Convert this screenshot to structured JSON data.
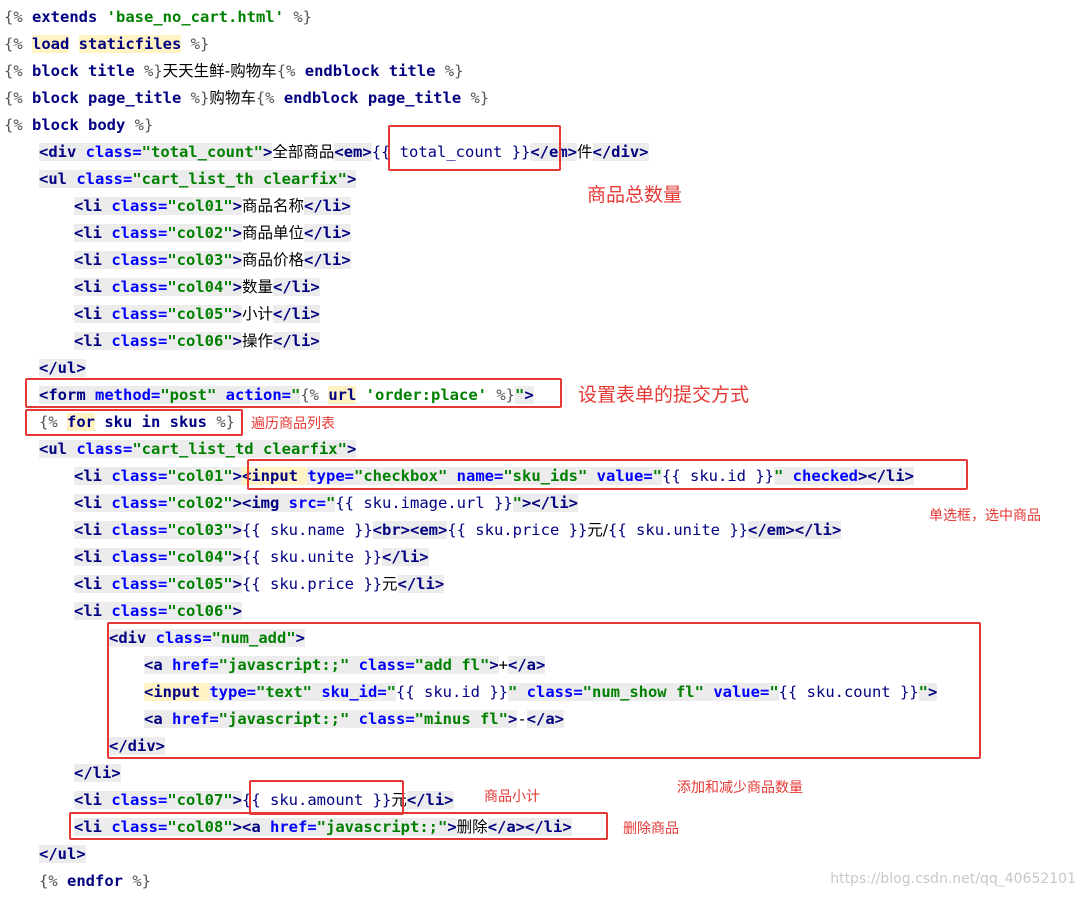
{
  "code_lines": [
    {
      "indent": 0,
      "tokens": [
        {
          "t": "{% ",
          "c": "tmpl"
        },
        {
          "t": "extends",
          "c": "kw"
        },
        {
          "t": " ",
          "c": "tmpl"
        },
        {
          "t": "'base_no_cart.html'",
          "c": "str"
        },
        {
          "t": " %}",
          "c": "tmpl"
        }
      ]
    },
    {
      "indent": 0,
      "tokens": [
        {
          "t": "{% ",
          "c": "tmpl"
        },
        {
          "t": "load",
          "c": "kw mark"
        },
        {
          "t": " ",
          "c": "tmpl"
        },
        {
          "t": "staticfiles",
          "c": "kw mark"
        },
        {
          "t": " %}",
          "c": "tmpl"
        }
      ]
    },
    {
      "indent": 0,
      "tokens": [
        {
          "t": "{% ",
          "c": "tmpl"
        },
        {
          "t": "block",
          "c": "kw"
        },
        {
          "t": " title ",
          "c": "kw"
        },
        {
          "t": "%}",
          "c": "tmpl"
        },
        {
          "t": "天天生鲜-购物车",
          "c": "txt-plain cjk"
        },
        {
          "t": "{% ",
          "c": "tmpl"
        },
        {
          "t": "endblock",
          "c": "kw"
        },
        {
          "t": " title ",
          "c": "kw"
        },
        {
          "t": "%}",
          "c": "tmpl"
        }
      ]
    },
    {
      "indent": 0,
      "tokens": [
        {
          "t": "{% ",
          "c": "tmpl"
        },
        {
          "t": "block",
          "c": "kw"
        },
        {
          "t": " page_title ",
          "c": "kw"
        },
        {
          "t": "%}",
          "c": "tmpl"
        },
        {
          "t": "购物车",
          "c": "txt-plain cjk"
        },
        {
          "t": "{% ",
          "c": "tmpl"
        },
        {
          "t": "endblock",
          "c": "kw"
        },
        {
          "t": " page_title ",
          "c": "kw"
        },
        {
          "t": "%}",
          "c": "tmpl"
        }
      ]
    },
    {
      "indent": 0,
      "tokens": [
        {
          "t": "{% ",
          "c": "tmpl"
        },
        {
          "t": "block",
          "c": "kw"
        },
        {
          "t": " body ",
          "c": "kw"
        },
        {
          "t": "%}",
          "c": "tmpl"
        }
      ]
    },
    {
      "indent": 1,
      "tokens": [
        {
          "t": "<div ",
          "c": "tag hl"
        },
        {
          "t": "class=",
          "c": "attr hl"
        },
        {
          "t": "\"total_count\"",
          "c": "str hl"
        },
        {
          "t": ">",
          "c": "tag hl"
        },
        {
          "t": "全部商品",
          "c": "txt-plain cjk"
        },
        {
          "t": "<em>",
          "c": "tag hl"
        },
        {
          "t": "{{ total_count }}",
          "c": "var"
        },
        {
          "t": "</em>",
          "c": "tag hl"
        },
        {
          "t": "件",
          "c": "txt-plain cjk"
        },
        {
          "t": "</div>",
          "c": "tag hl"
        }
      ]
    },
    {
      "indent": 1,
      "tokens": [
        {
          "t": "<ul ",
          "c": "tag hl"
        },
        {
          "t": "class=",
          "c": "attr hl"
        },
        {
          "t": "\"cart_list_th clearfix\"",
          "c": "str hl"
        },
        {
          "t": ">",
          "c": "tag hl"
        }
      ]
    },
    {
      "indent": 2,
      "tokens": [
        {
          "t": "<li ",
          "c": "tag hl"
        },
        {
          "t": "class=",
          "c": "attr hl"
        },
        {
          "t": "\"col01\"",
          "c": "str hl"
        },
        {
          "t": ">",
          "c": "tag hl"
        },
        {
          "t": "商品名称",
          "c": "txt-plain cjk"
        },
        {
          "t": "</li>",
          "c": "tag hl"
        }
      ]
    },
    {
      "indent": 2,
      "tokens": [
        {
          "t": "<li ",
          "c": "tag hl"
        },
        {
          "t": "class=",
          "c": "attr hl"
        },
        {
          "t": "\"col02\"",
          "c": "str hl"
        },
        {
          "t": ">",
          "c": "tag hl"
        },
        {
          "t": "商品单位",
          "c": "txt-plain cjk"
        },
        {
          "t": "</li>",
          "c": "tag hl"
        }
      ]
    },
    {
      "indent": 2,
      "tokens": [
        {
          "t": "<li ",
          "c": "tag hl"
        },
        {
          "t": "class=",
          "c": "attr hl"
        },
        {
          "t": "\"col03\"",
          "c": "str hl"
        },
        {
          "t": ">",
          "c": "tag hl"
        },
        {
          "t": "商品价格",
          "c": "txt-plain cjk"
        },
        {
          "t": "</li>",
          "c": "tag hl"
        }
      ]
    },
    {
      "indent": 2,
      "tokens": [
        {
          "t": "<li ",
          "c": "tag hl"
        },
        {
          "t": "class=",
          "c": "attr hl"
        },
        {
          "t": "\"col04\"",
          "c": "str hl"
        },
        {
          "t": ">",
          "c": "tag hl"
        },
        {
          "t": "数量",
          "c": "txt-plain cjk"
        },
        {
          "t": "</li>",
          "c": "tag hl"
        }
      ]
    },
    {
      "indent": 2,
      "tokens": [
        {
          "t": "<li ",
          "c": "tag hl"
        },
        {
          "t": "class=",
          "c": "attr hl"
        },
        {
          "t": "\"col05\"",
          "c": "str hl"
        },
        {
          "t": ">",
          "c": "tag hl"
        },
        {
          "t": "小计",
          "c": "txt-plain cjk"
        },
        {
          "t": "</li>",
          "c": "tag hl"
        }
      ]
    },
    {
      "indent": 2,
      "tokens": [
        {
          "t": "<li ",
          "c": "tag hl"
        },
        {
          "t": "class=",
          "c": "attr hl"
        },
        {
          "t": "\"col06\"",
          "c": "str hl"
        },
        {
          "t": ">",
          "c": "tag hl"
        },
        {
          "t": "操作",
          "c": "txt-plain cjk"
        },
        {
          "t": "</li>",
          "c": "tag hl"
        }
      ]
    },
    {
      "indent": 1,
      "tokens": [
        {
          "t": "</ul>",
          "c": "tag hl"
        }
      ]
    },
    {
      "indent": 1,
      "tokens": [
        {
          "t": "<form ",
          "c": "tag hl"
        },
        {
          "t": "method=",
          "c": "attr hl"
        },
        {
          "t": "\"post\"",
          "c": "str hl"
        },
        {
          "t": " action=",
          "c": "attr hl"
        },
        {
          "t": "\"",
          "c": "str hl"
        },
        {
          "t": "{% ",
          "c": "tmpl"
        },
        {
          "t": "url",
          "c": "kw mark"
        },
        {
          "t": " ",
          "c": "tmpl"
        },
        {
          "t": "'order:place'",
          "c": "str"
        },
        {
          "t": " %}",
          "c": "tmpl"
        },
        {
          "t": "\"",
          "c": "str hl"
        },
        {
          "t": ">",
          "c": "tag hl"
        }
      ]
    },
    {
      "indent": 1,
      "tokens": [
        {
          "t": "{% ",
          "c": "tmpl"
        },
        {
          "t": "for",
          "c": "kw mark"
        },
        {
          "t": " sku ",
          "c": "kw"
        },
        {
          "t": "in",
          "c": "kw"
        },
        {
          "t": " skus ",
          "c": "kw"
        },
        {
          "t": "%}",
          "c": "tmpl"
        }
      ]
    },
    {
      "indent": 1,
      "tokens": [
        {
          "t": "<ul ",
          "c": "tag hl"
        },
        {
          "t": "class=",
          "c": "attr hl"
        },
        {
          "t": "\"cart_list_td clearfix\"",
          "c": "str hl"
        },
        {
          "t": ">",
          "c": "tag hl"
        }
      ]
    },
    {
      "indent": 2,
      "tokens": [
        {
          "t": "<li ",
          "c": "tag hl"
        },
        {
          "t": "class=",
          "c": "attr hl"
        },
        {
          "t": "\"col01\"",
          "c": "str hl"
        },
        {
          "t": ">",
          "c": "tag hl"
        },
        {
          "t": "<input ",
          "c": "tag mark"
        },
        {
          "t": "type=",
          "c": "attr hl"
        },
        {
          "t": "\"checkbox\"",
          "c": "str hl"
        },
        {
          "t": " name=",
          "c": "attr hl"
        },
        {
          "t": "\"sku_ids\"",
          "c": "str hl"
        },
        {
          "t": " value=",
          "c": "attr hl"
        },
        {
          "t": "\"",
          "c": "str hl"
        },
        {
          "t": "{{ sku.id }}",
          "c": "var"
        },
        {
          "t": "\"",
          "c": "str hl"
        },
        {
          "t": " checked",
          "c": "attr hl"
        },
        {
          "t": ">",
          "c": "tag hl"
        },
        {
          "t": "</li>",
          "c": "tag hl"
        }
      ]
    },
    {
      "indent": 2,
      "tokens": [
        {
          "t": "<li ",
          "c": "tag hl"
        },
        {
          "t": "class=",
          "c": "attr hl"
        },
        {
          "t": "\"col02\"",
          "c": "str hl"
        },
        {
          "t": ">",
          "c": "tag hl"
        },
        {
          "t": "<img ",
          "c": "tag hl"
        },
        {
          "t": "src=",
          "c": "attr hl"
        },
        {
          "t": "\"",
          "c": "str hl"
        },
        {
          "t": "{{ sku.image.url }}",
          "c": "var"
        },
        {
          "t": "\"",
          "c": "str hl"
        },
        {
          "t": ">",
          "c": "tag hl"
        },
        {
          "t": "</li>",
          "c": "tag hl"
        }
      ]
    },
    {
      "indent": 2,
      "tokens": [
        {
          "t": "<li ",
          "c": "tag hl"
        },
        {
          "t": "class=",
          "c": "attr hl"
        },
        {
          "t": "\"col03\"",
          "c": "str hl"
        },
        {
          "t": ">",
          "c": "tag hl"
        },
        {
          "t": "{{ sku.name }}",
          "c": "var"
        },
        {
          "t": "<br>",
          "c": "tag hl"
        },
        {
          "t": "<em>",
          "c": "tag hl"
        },
        {
          "t": "{{ sku.price }}",
          "c": "var"
        },
        {
          "t": "元/",
          "c": "txt-plain cjk"
        },
        {
          "t": "{{ sku.unite }}",
          "c": "var"
        },
        {
          "t": "</em>",
          "c": "tag hl"
        },
        {
          "t": "</li>",
          "c": "tag hl"
        }
      ]
    },
    {
      "indent": 2,
      "tokens": [
        {
          "t": "<li ",
          "c": "tag hl"
        },
        {
          "t": "class=",
          "c": "attr hl"
        },
        {
          "t": "\"col04\"",
          "c": "str hl"
        },
        {
          "t": ">",
          "c": "tag hl"
        },
        {
          "t": "{{ sku.unite }}",
          "c": "var"
        },
        {
          "t": "</li>",
          "c": "tag hl"
        }
      ]
    },
    {
      "indent": 2,
      "tokens": [
        {
          "t": "<li ",
          "c": "tag hl"
        },
        {
          "t": "class=",
          "c": "attr hl"
        },
        {
          "t": "\"col05\"",
          "c": "str hl"
        },
        {
          "t": ">",
          "c": "tag hl"
        },
        {
          "t": "{{ sku.price }}",
          "c": "var"
        },
        {
          "t": "元",
          "c": "txt-plain cjk"
        },
        {
          "t": "</li>",
          "c": "tag hl"
        }
      ]
    },
    {
      "indent": 2,
      "tokens": [
        {
          "t": "<li ",
          "c": "tag hl"
        },
        {
          "t": "class=",
          "c": "attr hl"
        },
        {
          "t": "\"col06\"",
          "c": "str hl"
        },
        {
          "t": ">",
          "c": "tag hl"
        }
      ]
    },
    {
      "indent": 3,
      "tokens": [
        {
          "t": "<div ",
          "c": "tag hl"
        },
        {
          "t": "class=",
          "c": "attr hl"
        },
        {
          "t": "\"num_add\"",
          "c": "str hl"
        },
        {
          "t": ">",
          "c": "tag hl"
        }
      ]
    },
    {
      "indent": 4,
      "tokens": [
        {
          "t": "<a ",
          "c": "tag hl"
        },
        {
          "t": "href=",
          "c": "attr hl"
        },
        {
          "t": "\"javascript:;\"",
          "c": "str hl"
        },
        {
          "t": " class=",
          "c": "attr hl"
        },
        {
          "t": "\"add fl\"",
          "c": "str hl"
        },
        {
          "t": ">",
          "c": "tag hl"
        },
        {
          "t": "+",
          "c": "txt-plain"
        },
        {
          "t": "</a>",
          "c": "tag hl"
        }
      ]
    },
    {
      "indent": 4,
      "tokens": [
        {
          "t": "<input ",
          "c": "tag mark"
        },
        {
          "t": "type=",
          "c": "attr hl"
        },
        {
          "t": "\"text\"",
          "c": "str hl"
        },
        {
          "t": " sku_id=",
          "c": "attr hl"
        },
        {
          "t": "\"",
          "c": "str hl"
        },
        {
          "t": "{{ sku.id }}",
          "c": "var"
        },
        {
          "t": "\"",
          "c": "str hl"
        },
        {
          "t": " class=",
          "c": "attr hl"
        },
        {
          "t": "\"num_show fl\"",
          "c": "str hl"
        },
        {
          "t": " value=",
          "c": "attr hl"
        },
        {
          "t": "\"",
          "c": "str hl"
        },
        {
          "t": "{{ sku.count }}",
          "c": "var"
        },
        {
          "t": "\"",
          "c": "str hl"
        },
        {
          "t": ">",
          "c": "tag hl"
        }
      ]
    },
    {
      "indent": 4,
      "tokens": [
        {
          "t": "<a ",
          "c": "tag hl"
        },
        {
          "t": "href=",
          "c": "attr hl"
        },
        {
          "t": "\"javascript:;\"",
          "c": "str hl"
        },
        {
          "t": " class=",
          "c": "attr hl"
        },
        {
          "t": "\"minus fl\"",
          "c": "str hl"
        },
        {
          "t": ">",
          "c": "tag hl"
        },
        {
          "t": "-",
          "c": "txt-plain"
        },
        {
          "t": "</a>",
          "c": "tag hl"
        }
      ]
    },
    {
      "indent": 3,
      "tokens": [
        {
          "t": "</div>",
          "c": "tag hl"
        }
      ]
    },
    {
      "indent": 2,
      "tokens": [
        {
          "t": "</li>",
          "c": "tag hl"
        }
      ]
    },
    {
      "indent": 2,
      "tokens": [
        {
          "t": "<li ",
          "c": "tag hl"
        },
        {
          "t": "class=",
          "c": "attr hl"
        },
        {
          "t": "\"col07\"",
          "c": "str hl"
        },
        {
          "t": ">",
          "c": "tag hl"
        },
        {
          "t": "{{ sku.amount }}",
          "c": "var"
        },
        {
          "t": "元",
          "c": "txt-plain cjk"
        },
        {
          "t": "</li>",
          "c": "tag hl"
        }
      ]
    },
    {
      "indent": 2,
      "tokens": [
        {
          "t": "<li ",
          "c": "tag hl"
        },
        {
          "t": "class=",
          "c": "attr hl"
        },
        {
          "t": "\"col08\"",
          "c": "str hl"
        },
        {
          "t": ">",
          "c": "tag hl"
        },
        {
          "t": "<a ",
          "c": "tag hl"
        },
        {
          "t": "href=",
          "c": "attr hl"
        },
        {
          "t": "\"javascript:;\"",
          "c": "str hl"
        },
        {
          "t": ">",
          "c": "tag hl"
        },
        {
          "t": "删除",
          "c": "txt-plain cjk"
        },
        {
          "t": "</a>",
          "c": "tag hl"
        },
        {
          "t": "</li>",
          "c": "tag hl"
        }
      ]
    },
    {
      "indent": 1,
      "tokens": [
        {
          "t": "</ul>",
          "c": "tag hl"
        }
      ]
    },
    {
      "indent": 1,
      "tokens": [
        {
          "t": "{% ",
          "c": "tmpl"
        },
        {
          "t": "endfor",
          "c": "kw"
        },
        {
          "t": " %}",
          "c": "tmpl"
        }
      ]
    }
  ],
  "annotations": {
    "total_count": "商品总数量",
    "form_submit": "设置表单的提交方式",
    "for_loop": "遍历商品列表",
    "checkbox": "单选框，选中商品",
    "num_add": "添加和减少商品数量",
    "amount": "商品小计",
    "delete": "删除商品"
  },
  "watermark": "https://blog.csdn.net/qq_40652101",
  "colors": {
    "annotation_red": "#e53935",
    "background": "#ffffff"
  }
}
